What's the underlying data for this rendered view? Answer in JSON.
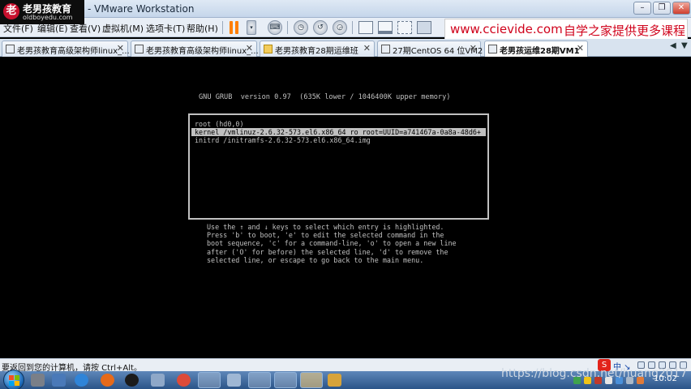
{
  "window": {
    "title": "- VMware Workstation",
    "controls": {
      "minimize": "–",
      "restore": "❐",
      "close": "✕"
    }
  },
  "logo": {
    "mark": "老",
    "name": "老男孩教育",
    "site": "oldboyedu.com"
  },
  "menu": {
    "items": [
      {
        "label": "文件(F)"
      },
      {
        "label": "编辑(E)"
      },
      {
        "label": "查看(V)"
      },
      {
        "label": "虚拟机(M)"
      },
      {
        "label": "选项卡(T)"
      },
      {
        "label": "帮助(H)"
      }
    ]
  },
  "toolbar": {
    "icons": [
      "pause-icon",
      "send-keys-icon",
      "snapshot-icon",
      "revert-snapshot-icon",
      "snapshot-manager-icon",
      "show-library-icon",
      "thumbnail-icon",
      "fit-guest-icon",
      "fullscreen-icon",
      "unity-icon"
    ]
  },
  "promo": {
    "site": "www.ccievide.com",
    "text": "自学之家提供更多课程"
  },
  "tabs": [
    {
      "label": "老男孩教育高级架构师linux_...",
      "icon": "vm-icon",
      "active": false
    },
    {
      "label": "老男孩教育高级架构师linux_...",
      "icon": "vm-icon",
      "active": false
    },
    {
      "label": "老男孩教育28期运维班",
      "icon": "folder-icon",
      "active": false
    },
    {
      "label": "27期CentOS 64 位VM2",
      "icon": "vm-icon",
      "active": false
    },
    {
      "label": "老男孩运维28期VM1",
      "icon": "vm-icon",
      "active": true
    }
  ],
  "tab_close": "✕",
  "tab_nav": {
    "prev": "◀",
    "next": "▼"
  },
  "grub": {
    "header": "GNU GRUB  version 0.97  (635K lower / 1046400K upper memory)",
    "entries": [
      {
        "text": "root (hd0,0)",
        "selected": false
      },
      {
        "text": "kernel /vmlinuz-2.6.32-573.el6.x86_64 ro root=UUID=a741467a-0a8a-48d6+",
        "selected": true
      },
      {
        "text": "initrd /initramfs-2.6.32-573.el6.x86_64.img",
        "selected": false
      }
    ],
    "help": [
      "Use the ↑ and ↓ keys to select which entry is highlighted.",
      "Press 'b' to boot, 'e' to edit the selected command in the",
      "boot sequence, 'c' for a command-line, 'o' to open a new line",
      "after ('O' for before) the selected line, 'd' to remove the",
      "selected line, or escape to go back to the main menu."
    ]
  },
  "status": {
    "text": "要返回到您的计算机，请按 Ctrl+Alt。",
    "ime_logo": "S",
    "ime_mode": "中 ↘"
  },
  "taskbar": {
    "clock": "10:02",
    "watermark": "https://blog.csdn.net/huang2017"
  },
  "colors": {
    "grub_text": "#c0c0c0",
    "grub_background": "#000000",
    "promo_red": "#d0021b",
    "taskbar": "#2b5488"
  }
}
